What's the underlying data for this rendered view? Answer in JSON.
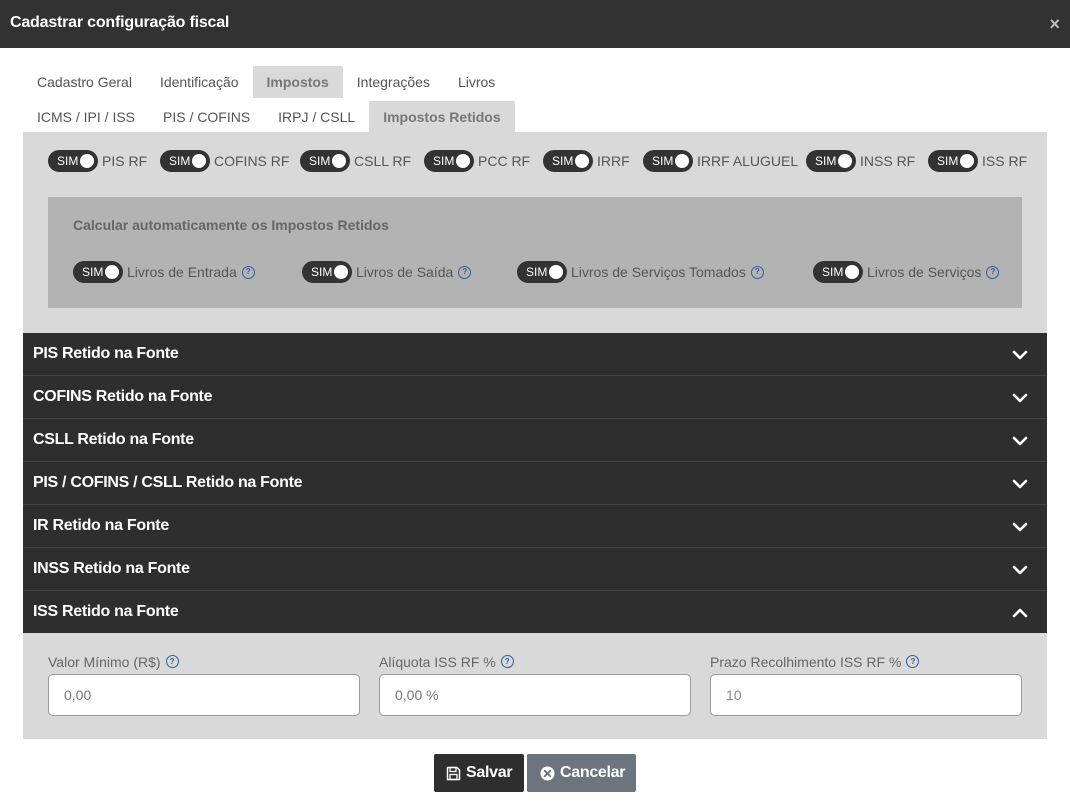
{
  "window": {
    "title": "Cadastrar configuração fiscal",
    "close_glyph": "×"
  },
  "tabs_primary": [
    {
      "label": "Cadastro Geral",
      "active": false
    },
    {
      "label": "Identificação",
      "active": false
    },
    {
      "label": "Impostos",
      "active": true
    },
    {
      "label": "Integrações",
      "active": false
    },
    {
      "label": "Livros",
      "active": false
    }
  ],
  "tabs_secondary": [
    {
      "label": "ICMS / IPI / ISS",
      "active": false
    },
    {
      "label": "PIS / COFINS",
      "active": false
    },
    {
      "label": "IRPJ / CSLL",
      "active": false
    },
    {
      "label": "Impostos Retidos",
      "active": true
    }
  ],
  "retained_toggles": [
    {
      "state": "SIM",
      "label": "PIS RF"
    },
    {
      "state": "SIM",
      "label": "COFINS RF"
    },
    {
      "state": "SIM",
      "label": "CSLL RF"
    },
    {
      "state": "SIM",
      "label": "PCC RF"
    },
    {
      "state": "SIM",
      "label": "IRRF"
    },
    {
      "state": "SIM",
      "label": "IRRF ALUGUEL"
    },
    {
      "state": "SIM",
      "label": "INSS RF"
    },
    {
      "state": "SIM",
      "label": "ISS RF"
    }
  ],
  "auto_calc": {
    "heading": "Calcular automaticamente os Impostos Retidos",
    "toggles": [
      {
        "state": "SIM",
        "label": "Livros de Entrada",
        "help": "?"
      },
      {
        "state": "SIM",
        "label": "Livros de Saída",
        "help": "?"
      },
      {
        "state": "SIM",
        "label": "Livros de Serviços Tomados",
        "help": "?"
      },
      {
        "state": "SIM",
        "label": "Livros de Serviços",
        "help": "?"
      }
    ]
  },
  "accordion": [
    {
      "label": "PIS Retido na Fonte",
      "expanded": false
    },
    {
      "label": "COFINS Retido na Fonte",
      "expanded": false
    },
    {
      "label": "CSLL Retido na Fonte",
      "expanded": false
    },
    {
      "label": "PIS / COFINS / CSLL Retido na Fonte",
      "expanded": false
    },
    {
      "label": "IR Retido na Fonte",
      "expanded": false
    },
    {
      "label": "INSS Retido na Fonte",
      "expanded": false
    },
    {
      "label": "ISS Retido na Fonte",
      "expanded": true
    }
  ],
  "iss_fields": [
    {
      "label": "Valor Mínimo (R$)",
      "value": "",
      "placeholder": "0,00"
    },
    {
      "label": "Alíquota ISS RF %",
      "value": "",
      "placeholder": "0,00 %"
    },
    {
      "label": "Prazo Recolhimento ISS RF %",
      "value": "10",
      "placeholder": ""
    }
  ],
  "footer": {
    "save_label": "Salvar",
    "cancel_label": "Cancelar"
  },
  "colors": {
    "titlebar": "#323232",
    "accordion_header": "#2e2e2e",
    "panel_bg": "#d9d9d9",
    "inner_box": "#b3b3b3",
    "help_icon": "#2f5fa0",
    "cancel_button": "#6c757d"
  }
}
